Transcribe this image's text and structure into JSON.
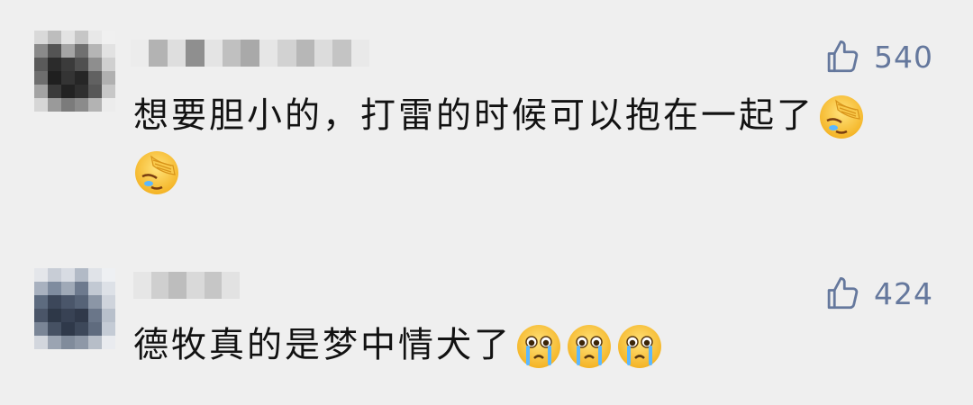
{
  "comments": [
    {
      "text": "想要胆小的，打雷的时候可以抱在一起了",
      "likes": "540",
      "emoji": [
        "facepalm-emoji",
        "facepalm-emoji"
      ]
    },
    {
      "text": "德牧真的是梦中情犬了",
      "likes": "424",
      "emoji": [
        "crying-emoji",
        "crying-emoji",
        "crying-emoji"
      ]
    }
  ],
  "colors": {
    "background": "#efefef",
    "text": "#121212",
    "like": "#65789d"
  }
}
